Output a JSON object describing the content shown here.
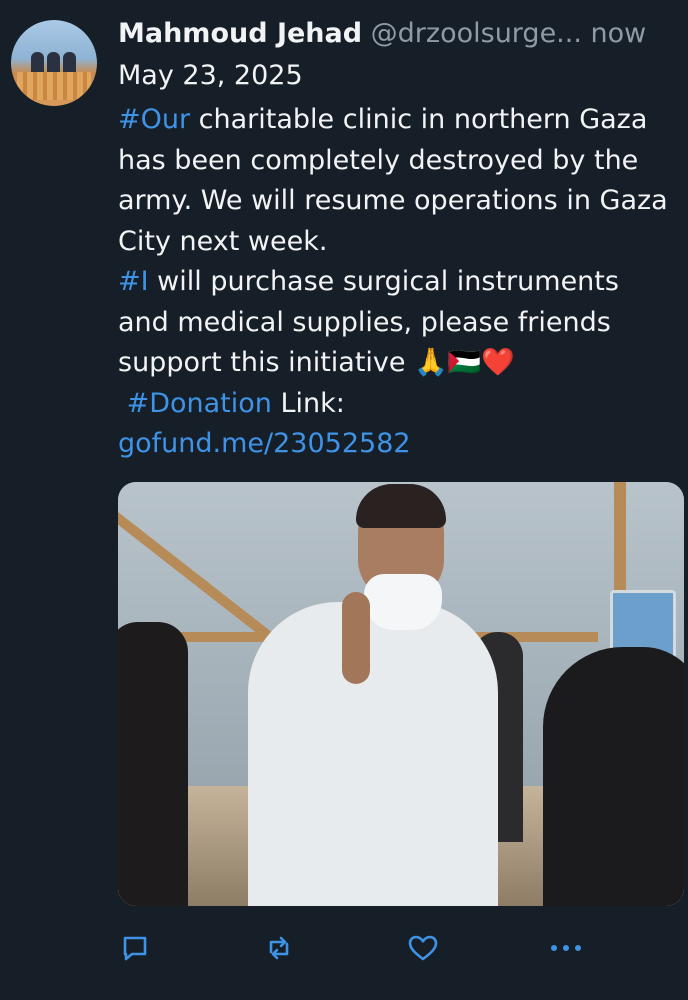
{
  "tweet": {
    "author_name": "Mahmoud Jehad",
    "author_handle": "@drzoolsurge...",
    "relative_time": "now",
    "date": "May 23, 2025",
    "body": {
      "tag_our": "#Our",
      "line_1": " charitable clinic in northern Gaza has been completely destroyed by the army. We will resume operations in Gaza City next week.\n",
      "tag_i": "#I",
      "line_2": " will purchase surgical instruments and medical supplies, please friends support this initiative 🙏🇵🇸❤️\n ",
      "tag_donation": "#Donation",
      "line_3": " Link:\n",
      "link": "gofund.me/23052582"
    }
  },
  "actions": {
    "reply_icon": "reply-icon",
    "retweet_icon": "retweet-icon",
    "like_icon": "heart-icon",
    "more_icon": "more-icon"
  },
  "colors": {
    "background": "#161e27",
    "link": "#3f93e6",
    "secondary_text": "#8f9aa6",
    "primary_text": "#f1f3f5"
  }
}
